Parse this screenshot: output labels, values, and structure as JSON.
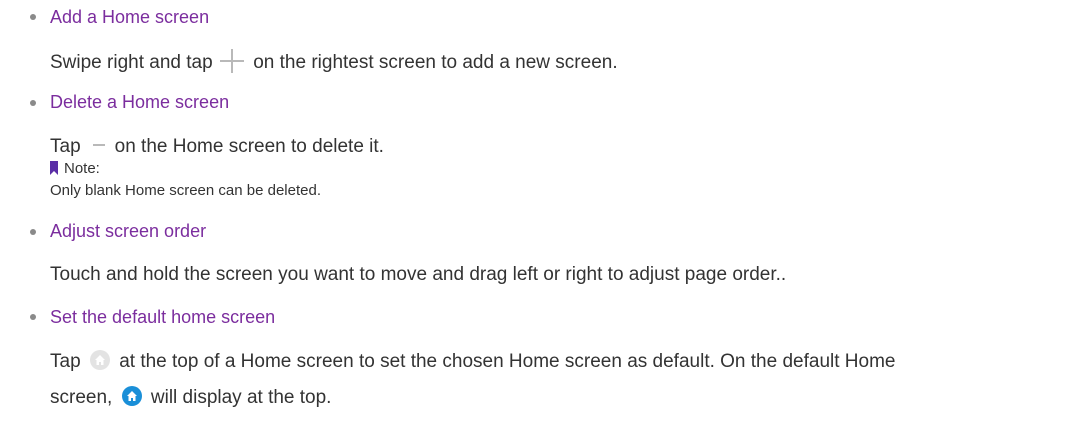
{
  "colors": {
    "heading": "#7b2d9e",
    "body": "#333333",
    "bullet": "#8a8a8a",
    "icon_grey": "#b9b9b9",
    "home_default_bg": "#1a8fd8",
    "note_bookmark": "#5a2ea6"
  },
  "items": [
    {
      "heading": "Add a Home screen",
      "body_before": "Swipe right and tap ",
      "body_icon": "plus-icon",
      "body_after": " on the rightest screen to add a new screen."
    },
    {
      "heading": "Delete a Home screen",
      "body_before": "Tap",
      "body_icon": "minus-icon",
      "body_after": "on the Home screen to delete it.",
      "note_label": "Note:",
      "note_text": "Only blank Home screen can be deleted."
    },
    {
      "heading": "Adjust screen order",
      "body": "Touch and hold the screen you want to move and drag left or right to adjust page order.."
    },
    {
      "heading": "Set the default home screen",
      "line1_before": "Tap ",
      "line1_icon": "home-grey-icon",
      "line1_after": " at the top of a Home screen to set the chosen Home screen as default. On the default Home",
      "line2_before": "screen, ",
      "line2_icon": "home-blue-icon",
      "line2_after": " will display at the top."
    }
  ]
}
